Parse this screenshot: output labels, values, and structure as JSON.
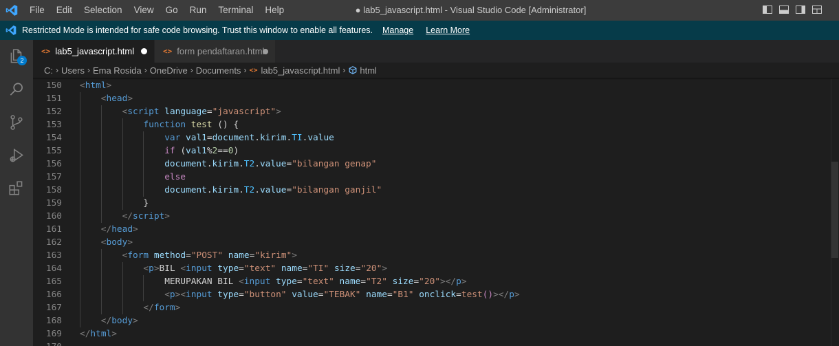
{
  "menu": [
    "File",
    "Edit",
    "Selection",
    "View",
    "Go",
    "Run",
    "Terminal",
    "Help"
  ],
  "window_title": "● lab5_javascript.html - Visual Studio Code [Administrator]",
  "banner": {
    "text": "Restricted Mode is intended for safe code browsing. Trust this window to enable all features.",
    "manage": "Manage",
    "learn_more": "Learn More"
  },
  "activity": {
    "explorer_badge": "2"
  },
  "tabs": [
    {
      "label": "lab5_javascript.html",
      "active": true,
      "icon": "html-file-icon",
      "modified": true
    },
    {
      "label": "form pendaftaran.html",
      "active": false,
      "icon": "html-file-icon",
      "modified": true
    }
  ],
  "breadcrumb": [
    "C:",
    "Users",
    "Ema Rosida",
    "OneDrive",
    "Documents",
    "lab5_javascript.html",
    "html"
  ],
  "colors": {
    "accent": "#007acc",
    "banner": "#063b49",
    "html_icon": "#e37933"
  },
  "code": [
    {
      "n": "150",
      "indent": 0,
      "tokens": [
        [
          "t-punc",
          "<"
        ],
        [
          "t-tag",
          "html"
        ],
        [
          "t-punc",
          ">"
        ]
      ]
    },
    {
      "n": "151",
      "indent": 1,
      "tokens": [
        [
          "t-punc",
          "<"
        ],
        [
          "t-tag",
          "head"
        ],
        [
          "t-punc",
          ">"
        ]
      ]
    },
    {
      "n": "152",
      "indent": 2,
      "tokens": [
        [
          "t-punc",
          "<"
        ],
        [
          "t-tag",
          "script"
        ],
        [
          "t-plain",
          " "
        ],
        [
          "t-attr",
          "language"
        ],
        [
          "t-plain",
          "="
        ],
        [
          "t-str",
          "\"javascript\""
        ],
        [
          "t-punc",
          ">"
        ]
      ]
    },
    {
      "n": "153",
      "indent": 3,
      "tokens": [
        [
          "t-kw",
          "function"
        ],
        [
          "t-plain",
          " "
        ],
        [
          "t-fn",
          "test"
        ],
        [
          "t-plain",
          " () {"
        ]
      ]
    },
    {
      "n": "154",
      "indent": 4,
      "tokens": [
        [
          "t-kw",
          "var"
        ],
        [
          "t-plain",
          " "
        ],
        [
          "t-var",
          "val1"
        ],
        [
          "t-plain",
          "="
        ],
        [
          "t-var",
          "document"
        ],
        [
          "t-plain",
          "."
        ],
        [
          "t-var",
          "kirim"
        ],
        [
          "t-plain",
          "."
        ],
        [
          "t-prop",
          "TI"
        ],
        [
          "t-plain",
          "."
        ],
        [
          "t-var",
          "value"
        ]
      ]
    },
    {
      "n": "155",
      "indent": 4,
      "tokens": [
        [
          "t-ctrl",
          "if"
        ],
        [
          "t-plain",
          " ("
        ],
        [
          "t-var",
          "val1"
        ],
        [
          "t-plain",
          "%"
        ],
        [
          "t-num",
          "2"
        ],
        [
          "t-plain",
          "=="
        ],
        [
          "t-num",
          "0"
        ],
        [
          "t-plain",
          ")"
        ]
      ]
    },
    {
      "n": "156",
      "indent": 4,
      "tokens": [
        [
          "t-var",
          "document"
        ],
        [
          "t-plain",
          "."
        ],
        [
          "t-var",
          "kirim"
        ],
        [
          "t-plain",
          "."
        ],
        [
          "t-prop",
          "T2"
        ],
        [
          "t-plain",
          "."
        ],
        [
          "t-var",
          "value"
        ],
        [
          "t-plain",
          "="
        ],
        [
          "t-str",
          "\"bilangan genap\""
        ]
      ]
    },
    {
      "n": "157",
      "indent": 4,
      "tokens": [
        [
          "t-ctrl",
          "else"
        ]
      ]
    },
    {
      "n": "158",
      "indent": 4,
      "tokens": [
        [
          "t-var",
          "document"
        ],
        [
          "t-plain",
          "."
        ],
        [
          "t-var",
          "kirim"
        ],
        [
          "t-plain",
          "."
        ],
        [
          "t-prop",
          "T2"
        ],
        [
          "t-plain",
          "."
        ],
        [
          "t-var",
          "value"
        ],
        [
          "t-plain",
          "="
        ],
        [
          "t-str",
          "\"bilangan ganjil\""
        ]
      ]
    },
    {
      "n": "159",
      "indent": 3,
      "tokens": [
        [
          "t-plain",
          "}"
        ]
      ]
    },
    {
      "n": "160",
      "indent": 2,
      "tokens": [
        [
          "t-punc",
          "</"
        ],
        [
          "t-tag",
          "script"
        ],
        [
          "t-punc",
          ">"
        ]
      ]
    },
    {
      "n": "161",
      "indent": 1,
      "tokens": [
        [
          "t-punc",
          "</"
        ],
        [
          "t-tag",
          "head"
        ],
        [
          "t-punc",
          ">"
        ]
      ]
    },
    {
      "n": "162",
      "indent": 1,
      "tokens": [
        [
          "t-punc",
          "<"
        ],
        [
          "t-tag",
          "body"
        ],
        [
          "t-punc",
          ">"
        ]
      ]
    },
    {
      "n": "163",
      "indent": 2,
      "tokens": [
        [
          "t-punc",
          "<"
        ],
        [
          "t-tag",
          "form"
        ],
        [
          "t-plain",
          " "
        ],
        [
          "t-attr",
          "method"
        ],
        [
          "t-plain",
          "="
        ],
        [
          "t-str",
          "\"POST\""
        ],
        [
          "t-plain",
          " "
        ],
        [
          "t-attr",
          "name"
        ],
        [
          "t-plain",
          "="
        ],
        [
          "t-str",
          "\"kirim\""
        ],
        [
          "t-punc",
          ">"
        ]
      ]
    },
    {
      "n": "164",
      "indent": 3,
      "tokens": [
        [
          "t-punc",
          "<"
        ],
        [
          "t-tag",
          "p"
        ],
        [
          "t-punc",
          ">"
        ],
        [
          "t-plain",
          "BIL "
        ],
        [
          "t-punc",
          "<"
        ],
        [
          "t-tag",
          "input"
        ],
        [
          "t-plain",
          " "
        ],
        [
          "t-attr",
          "type"
        ],
        [
          "t-plain",
          "="
        ],
        [
          "t-str",
          "\"text\""
        ],
        [
          "t-plain",
          " "
        ],
        [
          "t-attr",
          "name"
        ],
        [
          "t-plain",
          "="
        ],
        [
          "t-str",
          "\"TI\""
        ],
        [
          "t-plain",
          " "
        ],
        [
          "t-attr",
          "size"
        ],
        [
          "t-plain",
          "="
        ],
        [
          "t-str",
          "\"20\""
        ],
        [
          "t-punc",
          ">"
        ]
      ]
    },
    {
      "n": "165",
      "indent": 4,
      "tokens": [
        [
          "t-plain",
          "MERUPAKAN BIL "
        ],
        [
          "t-punc",
          "<"
        ],
        [
          "t-tag",
          "input"
        ],
        [
          "t-plain",
          " "
        ],
        [
          "t-attr",
          "type"
        ],
        [
          "t-plain",
          "="
        ],
        [
          "t-str",
          "\"text\""
        ],
        [
          "t-plain",
          " "
        ],
        [
          "t-attr",
          "name"
        ],
        [
          "t-plain",
          "="
        ],
        [
          "t-str",
          "\"T2\""
        ],
        [
          "t-plain",
          " "
        ],
        [
          "t-attr",
          "size"
        ],
        [
          "t-plain",
          "="
        ],
        [
          "t-str",
          "\"20\""
        ],
        [
          "t-punc",
          "></"
        ],
        [
          "t-tag",
          "p"
        ],
        [
          "t-punc",
          ">"
        ]
      ]
    },
    {
      "n": "166",
      "indent": 4,
      "tokens": [
        [
          "t-punc",
          "<"
        ],
        [
          "t-tag",
          "p"
        ],
        [
          "t-punc",
          "><"
        ],
        [
          "t-tag",
          "input"
        ],
        [
          "t-plain",
          " "
        ],
        [
          "t-attr",
          "type"
        ],
        [
          "t-plain",
          "="
        ],
        [
          "t-str",
          "\"button\""
        ],
        [
          "t-plain",
          " "
        ],
        [
          "t-attr",
          "value"
        ],
        [
          "t-plain",
          "="
        ],
        [
          "t-str",
          "\"TEBAK\""
        ],
        [
          "t-plain",
          " "
        ],
        [
          "t-attr",
          "name"
        ],
        [
          "t-plain",
          "="
        ],
        [
          "t-str",
          "\"B1\""
        ],
        [
          "t-plain",
          " "
        ],
        [
          "t-attr",
          "onclick"
        ],
        [
          "t-plain",
          "="
        ],
        [
          "t-str",
          "test"
        ],
        [
          "t-ctrl",
          "()"
        ],
        [
          "t-punc",
          "></"
        ],
        [
          "t-tag",
          "p"
        ],
        [
          "t-punc",
          ">"
        ]
      ]
    },
    {
      "n": "167",
      "indent": 3,
      "tokens": [
        [
          "t-punc",
          "</"
        ],
        [
          "t-tag",
          "form"
        ],
        [
          "t-punc",
          ">"
        ]
      ]
    },
    {
      "n": "168",
      "indent": 1,
      "tokens": [
        [
          "t-punc",
          "</"
        ],
        [
          "t-tag",
          "body"
        ],
        [
          "t-punc",
          ">"
        ]
      ]
    },
    {
      "n": "169",
      "indent": 0,
      "tokens": [
        [
          "t-punc",
          "</"
        ],
        [
          "t-tag",
          "html"
        ],
        [
          "t-punc",
          ">"
        ]
      ]
    },
    {
      "n": "170",
      "indent": 0,
      "tokens": []
    }
  ]
}
